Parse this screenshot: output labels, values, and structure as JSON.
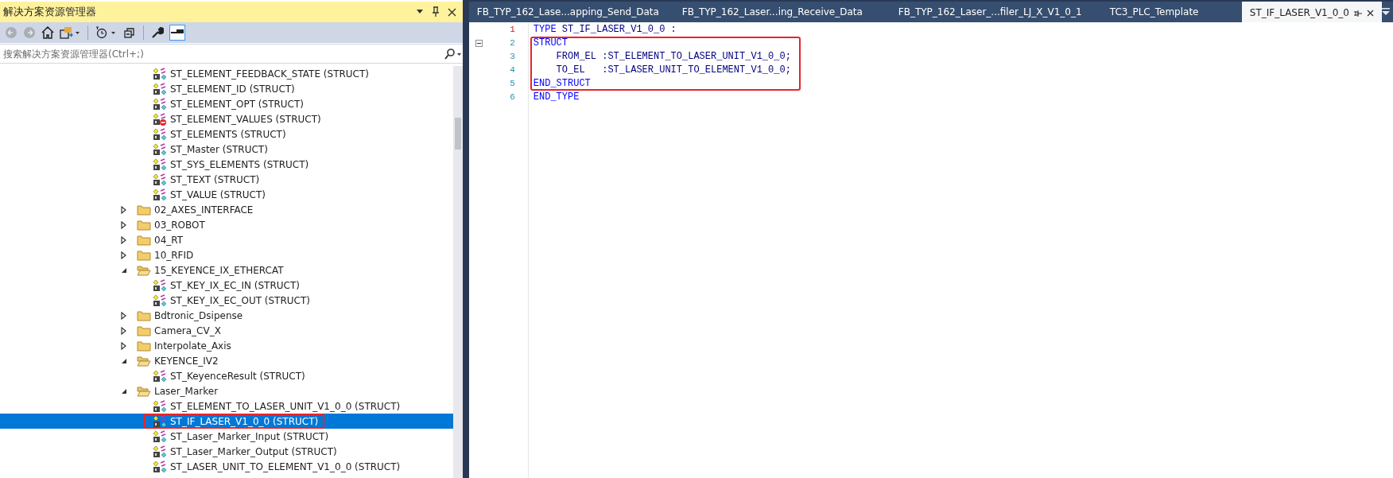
{
  "solution_explorer": {
    "title": "解决方案资源管理器",
    "search": {
      "placeholder": "搜索解决方案资源管理器(Ctrl+;)"
    },
    "tree": {
      "loose_items": [
        {
          "label": "ST_ELEMENT_FEEDBACK_STATE (STRUCT)",
          "blocked": false,
          "selected": false,
          "annotated": false
        },
        {
          "label": "ST_ELEMENT_ID (STRUCT)",
          "blocked": false,
          "selected": false,
          "annotated": false
        },
        {
          "label": "ST_ELEMENT_OPT (STRUCT)",
          "blocked": false,
          "selected": false,
          "annotated": false
        },
        {
          "label": "ST_ELEMENT_VALUES (STRUCT)",
          "blocked": true,
          "selected": false,
          "annotated": false
        },
        {
          "label": "ST_ELEMENTS (STRUCT)",
          "blocked": false,
          "selected": false,
          "annotated": false
        },
        {
          "label": "ST_Master (STRUCT)",
          "blocked": false,
          "selected": false,
          "annotated": false
        },
        {
          "label": "ST_SYS_ELEMENTS (STRUCT)",
          "blocked": false,
          "selected": false,
          "annotated": false
        },
        {
          "label": "ST_TEXT (STRUCT)",
          "blocked": false,
          "selected": false,
          "annotated": false
        },
        {
          "label": "ST_VALUE (STRUCT)",
          "blocked": false,
          "selected": false,
          "annotated": false
        }
      ],
      "folders": [
        {
          "label": "02_AXES_INTERFACE",
          "expanded": false
        },
        {
          "label": "03_ROBOT",
          "expanded": false
        },
        {
          "label": "04_RT",
          "expanded": false
        },
        {
          "label": "10_RFID",
          "expanded": false
        },
        {
          "label": "15_KEYENCE_IX_ETHERCAT",
          "expanded": true,
          "children": [
            {
              "label": "ST_KEY_IX_EC_IN (STRUCT)",
              "blocked": false,
              "selected": false,
              "annotated": false
            },
            {
              "label": "ST_KEY_IX_EC_OUT (STRUCT)",
              "blocked": false,
              "selected": false,
              "annotated": false
            }
          ]
        },
        {
          "label": "Bdtronic_Dsipense",
          "expanded": false
        },
        {
          "label": "Camera_CV_X",
          "expanded": false
        },
        {
          "label": "Interpolate_Axis",
          "expanded": false
        },
        {
          "label": "KEYENCE_IV2",
          "expanded": true,
          "children": [
            {
              "label": "ST_KeyenceResult (STRUCT)",
              "blocked": false,
              "selected": false,
              "annotated": false
            }
          ]
        },
        {
          "label": "Laser_Marker",
          "expanded": true,
          "children": [
            {
              "label": "ST_ELEMENT_TO_LASER_UNIT_V1_0_0 (STRUCT)",
              "blocked": false,
              "selected": false,
              "annotated": false
            },
            {
              "label": "ST_IF_LASER_V1_0_0 (STRUCT)",
              "blocked": false,
              "selected": true,
              "annotated": true
            },
            {
              "label": "ST_Laser_Marker_Input (STRUCT)",
              "blocked": false,
              "selected": false,
              "annotated": false
            },
            {
              "label": "ST_Laser_Marker_Output (STRUCT)",
              "blocked": false,
              "selected": false,
              "annotated": false
            },
            {
              "label": "ST_LASER_UNIT_TO_ELEMENT_V1_0_0 (STRUCT)",
              "blocked": false,
              "selected": false,
              "annotated": false
            }
          ]
        }
      ]
    }
  },
  "editor": {
    "tabs": [
      {
        "label": "FB_TYP_162_Lase...apping_Send_Data",
        "selected": false
      },
      {
        "label": "FB_TYP_162_Laser...ing_Receive_Data",
        "selected": false
      },
      {
        "label": "FB_TYP_162_Laser_...filer_LJ_X_V1_0_1",
        "selected": false
      },
      {
        "label": "TC3_PLC_Template",
        "selected": false
      },
      {
        "label": "ST_IF_LASER_V1_0_0",
        "selected": true
      }
    ],
    "lines": [
      {
        "number": "1",
        "current": true,
        "foldable": false,
        "annotated": false,
        "segments": [
          {
            "text": "TYPE",
            "kind": "keyword"
          },
          {
            "text": " ST_IF_LASER_V1_0_0 :",
            "kind": "plain"
          }
        ]
      },
      {
        "number": "2",
        "current": false,
        "foldable": true,
        "annotated": true,
        "segments": [
          {
            "text": "STRUCT",
            "kind": "keyword"
          }
        ]
      },
      {
        "number": "3",
        "current": false,
        "foldable": false,
        "annotated": true,
        "segments": [
          {
            "text": "    FROM_EL :ST_ELEMENT_TO_LASER_UNIT_V1_0_0;",
            "kind": "plain"
          }
        ]
      },
      {
        "number": "4",
        "current": false,
        "foldable": false,
        "annotated": true,
        "segments": [
          {
            "text": "    TO_EL   :ST_LASER_UNIT_TO_ELEMENT_V1_0_0;",
            "kind": "plain"
          }
        ]
      },
      {
        "number": "5",
        "current": false,
        "foldable": false,
        "annotated": true,
        "segments": [
          {
            "text": "END_STRUCT",
            "kind": "keyword"
          }
        ]
      },
      {
        "number": "6",
        "current": false,
        "foldable": false,
        "annotated": false,
        "segments": [
          {
            "text": "END_TYPE",
            "kind": "keyword"
          }
        ]
      }
    ]
  }
}
